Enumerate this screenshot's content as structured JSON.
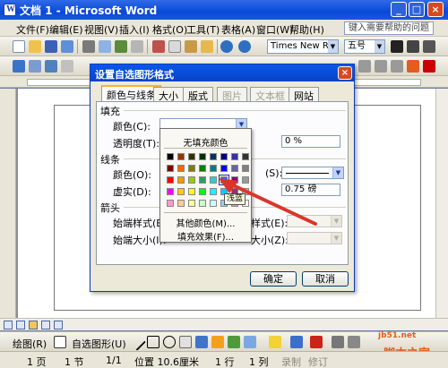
{
  "window": {
    "title": "文档 1 - Microsoft Word",
    "min": "_",
    "max": "□",
    "close": "×"
  },
  "menubar": {
    "items": [
      "文件(F)",
      "编辑(E)",
      "视图(V)",
      "插入(I)",
      "格式(O)",
      "工具(T)",
      "表格(A)",
      "窗口(W)",
      "帮助(H)"
    ],
    "help_placeholder": "键入需要帮助的问题"
  },
  "toolbar": {
    "font_name": "Times New Roman",
    "font_size": "五号"
  },
  "dialog": {
    "title": "设置自选图形格式",
    "close": "×",
    "tabs": [
      {
        "label": "颜色与线条",
        "active": true,
        "enabled": true
      },
      {
        "label": "大小",
        "active": false,
        "enabled": true
      },
      {
        "label": "版式",
        "active": false,
        "enabled": true
      },
      {
        "label": "图片",
        "active": false,
        "enabled": false
      },
      {
        "label": "文本框",
        "active": false,
        "enabled": false
      },
      {
        "label": "网站",
        "active": false,
        "enabled": true
      }
    ],
    "fill_group": "填充",
    "fill_color_label": "颜色(C):",
    "transparency_label": "透明度(T):",
    "transparency_value": "0 %",
    "line_group": "线条",
    "line_color_label": "颜色(O):",
    "line_style_label": "虚实(D):",
    "line_weight_suffix": "(S):",
    "line_weight_value": "0.75 磅",
    "arrows_group": "箭头",
    "begin_style_label": "始端样式(B):",
    "begin_size_label": "始端大小(I):",
    "end_style_label": "样式(E):",
    "end_size_label": "大小(Z):",
    "ok": "确定",
    "cancel": "取消"
  },
  "color_picker": {
    "no_fill": "无填充颜色",
    "more_colors": "其他颜色(M)...",
    "fill_effects": "填充效果(F)...",
    "tooltip": "浅蓝",
    "selected_color": "#3366ff",
    "swatches": [
      [
        "#000000",
        "#993300",
        "#333300",
        "#003300",
        "#003366",
        "#000080",
        "#333399",
        "#333333"
      ],
      [
        "#800000",
        "#ff6600",
        "#808000",
        "#008000",
        "#008080",
        "#0000ff",
        "#666699",
        "#808080"
      ],
      [
        "#ff0000",
        "#ff9900",
        "#99cc00",
        "#339966",
        "#33cccc",
        "#3366ff",
        "#800080",
        "#999999"
      ],
      [
        "#ff00ff",
        "#ffcc00",
        "#ffff00",
        "#00ff00",
        "#00ffff",
        "#00ccff",
        "#993366",
        "#c0c0c0"
      ],
      [
        "#ff99cc",
        "#ffcc99",
        "#ffff99",
        "#ccffcc",
        "#ccffff",
        "#99ccff",
        "#cc99ff",
        "#ffffff"
      ]
    ]
  },
  "drawbar": {
    "draw_label": "绘图(R)",
    "autoshapes_label": "自选图形(U)"
  },
  "statusbar": {
    "page": "1 页",
    "section": "1 节",
    "page_of": "1/1",
    "position": "位置 10.6厘米",
    "line": "1 行",
    "column": "1 列",
    "rec": "录制",
    "trk": "修订"
  },
  "watermark": {
    "url": "jb51.net",
    "site": "脚本之家"
  },
  "colors": {
    "accent_red": "#d9362b",
    "titlebar_blue": "#0a48d8"
  }
}
